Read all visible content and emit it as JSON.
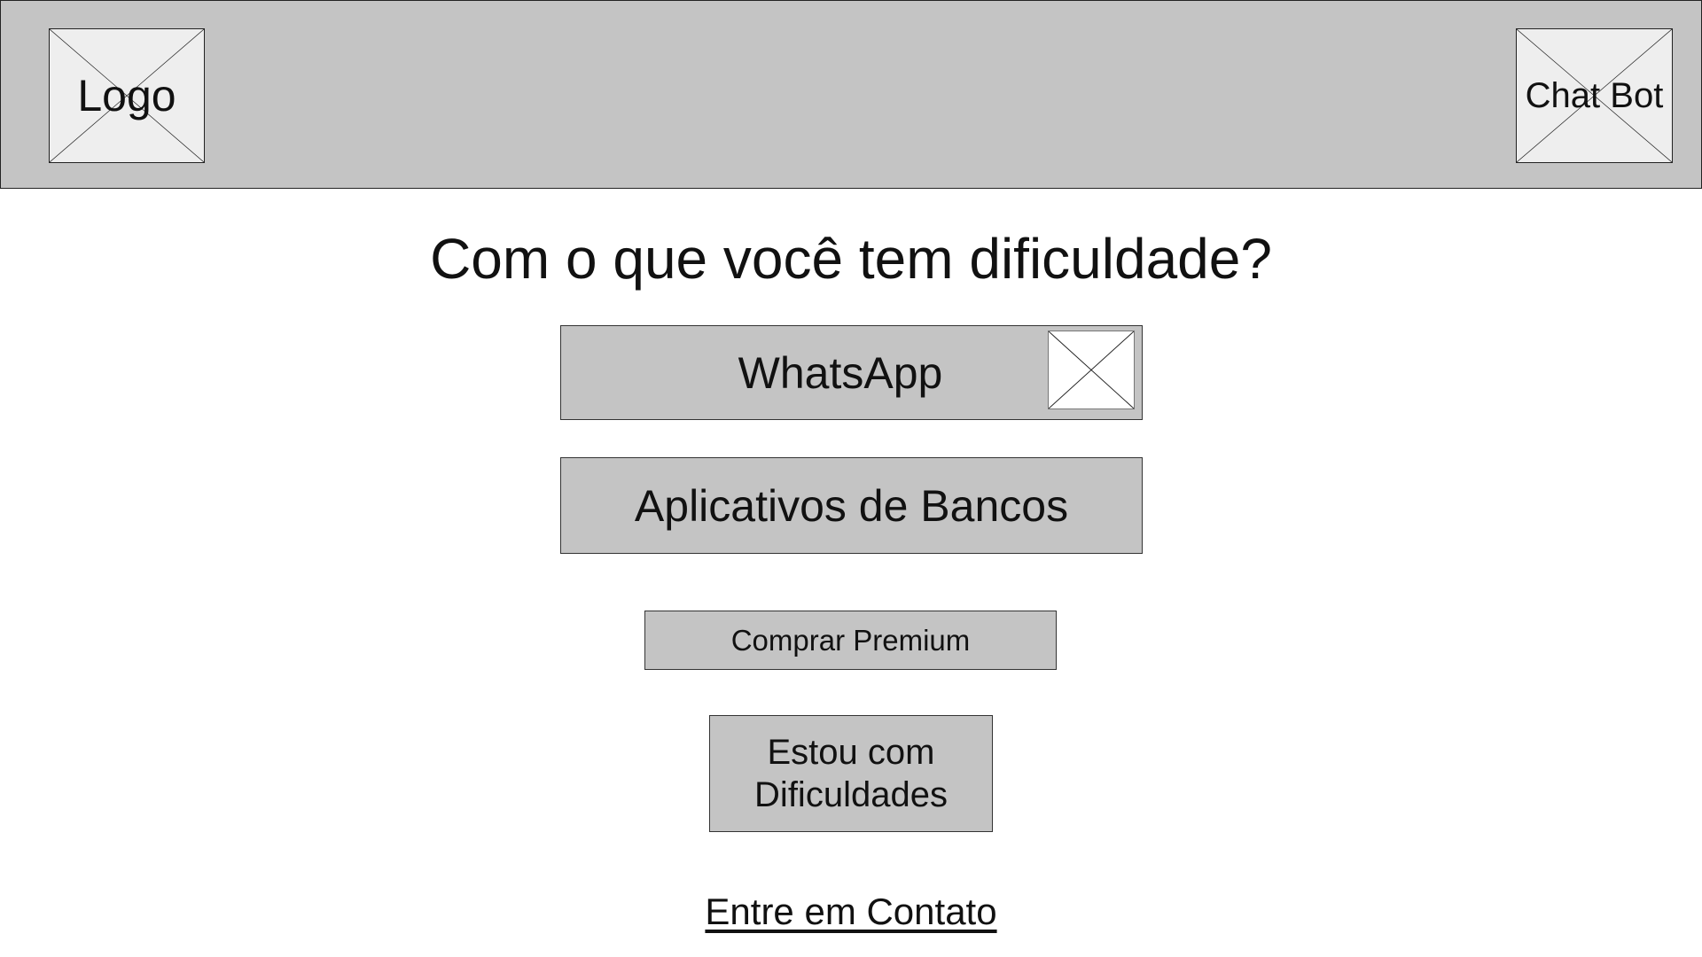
{
  "header": {
    "logo_label": "Logo",
    "chatbot_label": "Chat Bot"
  },
  "main": {
    "title": "Com o que você tem dificuldade?",
    "buttons": {
      "whatsapp": "WhatsApp",
      "bancos": "Aplicativos de Bancos",
      "premium": "Comprar Premium",
      "dificuldades": "Estou com\nDificuldades"
    },
    "contact_link": "Entre em Contato"
  },
  "colors": {
    "header_bg": "#c4c4c4",
    "button_bg": "#c4c4c4",
    "placeholder_bg": "#eeeeee"
  }
}
